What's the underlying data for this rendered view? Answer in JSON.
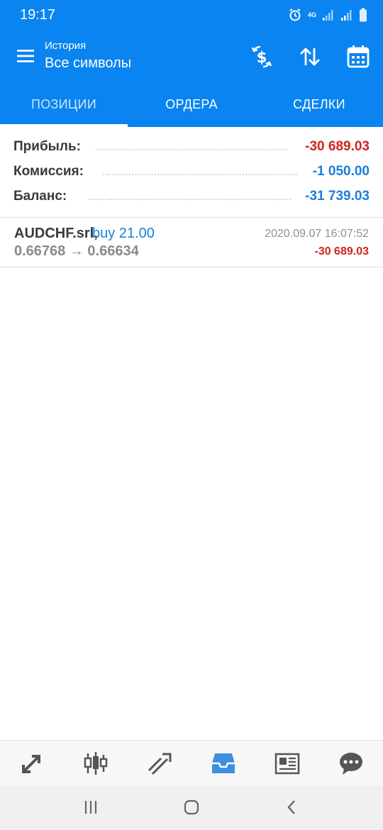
{
  "status_bar": {
    "time": "19:17",
    "network": "4G"
  },
  "toolbar": {
    "subtitle": "История",
    "title": "Все символы",
    "icons": [
      "menu-icon",
      "currency-exchange-icon",
      "sort-icon",
      "calendar-icon"
    ]
  },
  "tabs": [
    {
      "label": "ПОЗИЦИИ",
      "active": true
    },
    {
      "label": "ОРДЕРА",
      "active": false
    },
    {
      "label": "СДЕЛКИ",
      "active": false
    }
  ],
  "summary": {
    "profit": {
      "label": "Прибыль:",
      "value": "-30 689.03"
    },
    "commission": {
      "label": "Комиссия:",
      "value": "-1 050.00"
    },
    "balance": {
      "label": "Баланс:",
      "value": "-31 739.03"
    }
  },
  "deals": [
    {
      "symbol": "AUDCHF.srl,",
      "side": "buy 21.00",
      "prices": "0.66768 → 0.66634",
      "time": "2020.09.07 16:07:52",
      "profit": "-30 689.03"
    }
  ],
  "bottom_nav": [
    "quotes-icon",
    "chart-icon",
    "trade-icon",
    "history-icon",
    "news-icon",
    "chat-icon"
  ],
  "colors": {
    "accent": "#0a84f0",
    "negative": "#d0231f",
    "link": "#1a7fd8"
  }
}
